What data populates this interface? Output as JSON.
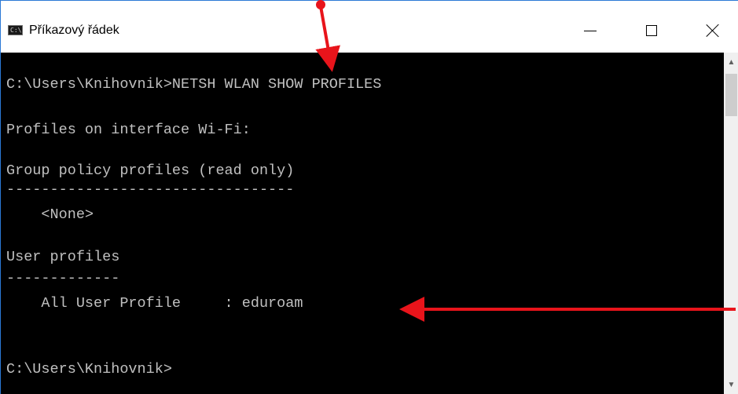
{
  "window": {
    "title": "Příkazový řádek",
    "icon_text": "C:\\"
  },
  "controls": {
    "minimize": "minimize-icon",
    "maximize": "maximize-icon",
    "close": "close-icon"
  },
  "console": {
    "lines": [
      "C:\\Users\\Knihovnik>NETSH WLAN SHOW PROFILES",
      "Profiles on interface Wi-Fi:",
      "Group policy profiles (read only)",
      "---------------------------------",
      "    <None>",
      "User profiles",
      "-------------",
      "    All User Profile     : eduroam",
      "C:\\Users\\Knihovnik>"
    ]
  },
  "scrollbar": {
    "up": "▲",
    "down": "▼"
  },
  "annotation_color": "#e8141b"
}
